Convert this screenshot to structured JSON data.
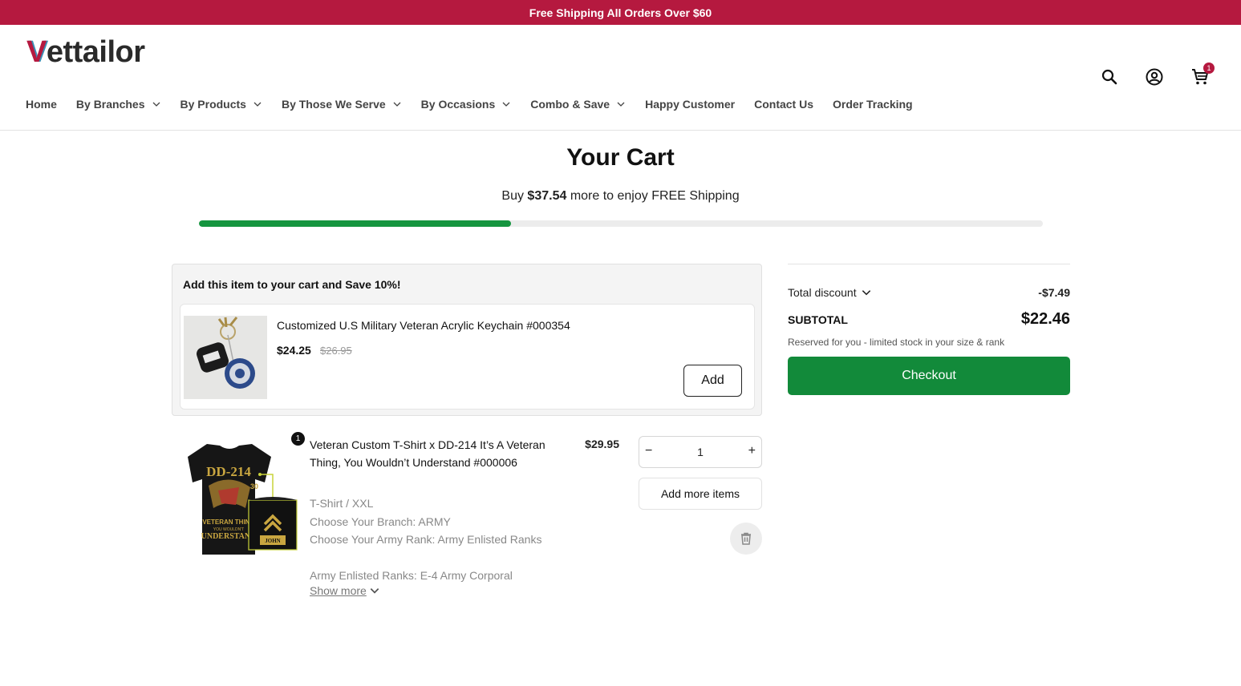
{
  "announcement": "Free Shipping All Orders Over $60",
  "brand": {
    "logo_first": "V",
    "logo_rest": "ettailor"
  },
  "nav": [
    {
      "label": "Home",
      "dropdown": false
    },
    {
      "label": "By Branches",
      "dropdown": true
    },
    {
      "label": "By Products",
      "dropdown": true
    },
    {
      "label": "By Those We Serve",
      "dropdown": true
    },
    {
      "label": "By Occasions",
      "dropdown": true
    },
    {
      "label": "Combo & Save",
      "dropdown": true
    },
    {
      "label": "Happy Customer",
      "dropdown": false
    },
    {
      "label": "Contact Us",
      "dropdown": false
    },
    {
      "label": "Order Tracking",
      "dropdown": false
    }
  ],
  "header_icons": {
    "search": "search-icon",
    "account": "account-icon",
    "cart": "cart-icon",
    "cart_count": "1"
  },
  "cart": {
    "title": "Your Cart",
    "shipping": {
      "prefix": "Buy",
      "amount": "$37.54",
      "suffix": "more to enjoy FREE Shipping",
      "progress": 0.37
    }
  },
  "upsell": {
    "heading": "Add this item to your cart and Save 10%!",
    "name": "Customized U.S Military Veteran Acrylic Keychain #000354",
    "price": "$24.25",
    "compare_price": "$26.95",
    "add_label": "Add"
  },
  "line_item": {
    "qty_badge": "1",
    "name": "Veteran Custom T-Shirt x DD-214 It’s A Veteran Thing, You Wouldn’t Understand #000006",
    "variant": "T-Shirt / XXL",
    "options": [
      "Choose Your Branch: ARMY",
      "Choose Your Army Rank: Army Enlisted Ranks",
      "Army Enlisted Ranks: E-4 Army Corporal"
    ],
    "show_more": "Show more",
    "price": "$29.95",
    "quantity": "1",
    "minus": "−",
    "plus": "+",
    "add_more_label": "Add more items",
    "print_text": {
      "front": "DD-214",
      "slogan_1": "VETERAN THING",
      "slogan_2": "YOU WOULDN'T",
      "slogan_3": "UNDERSTAND",
      "name": "JOHN",
      "side": "30"
    }
  },
  "summary": {
    "discount_label": "Total discount",
    "discount_value": "-$7.49",
    "subtotal_label": "SUBTOTAL",
    "subtotal_value": "$22.46",
    "reserved_note": "Reserved for you - limited stock in your size & rank",
    "checkout_label": "Checkout"
  },
  "colors": {
    "brand_red": "#b5193f",
    "checkout_green": "#128a3a",
    "progress_green": "#15953f"
  }
}
